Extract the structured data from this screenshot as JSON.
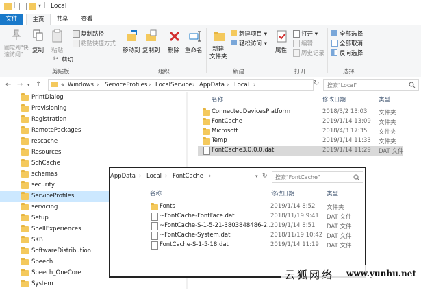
{
  "window": {
    "title": "Local"
  },
  "ribbon_tabs": {
    "file": "文件",
    "home": "主页",
    "share": "共享",
    "view": "查看"
  },
  "ribbon": {
    "pin_quick_access": "固定到\"快\n速访问\"",
    "copy": "复制",
    "paste": "粘贴",
    "copy_path": "复制路径",
    "paste_shortcut": "粘贴快捷方式",
    "cut": "剪切",
    "clipboard_group": "剪贴板",
    "move_to": "移动到",
    "copy_to": "复制到",
    "delete": "删除",
    "rename": "重命名",
    "organize_group": "组织",
    "new_folder": "新建\n文件夹",
    "new_item": "新建项目 ▾",
    "easy_access": "轻松访问 ▾",
    "new_group": "新建",
    "properties": "属性",
    "open": "打开 ▾",
    "edit": "编辑",
    "history": "历史记录",
    "open_group": "打开",
    "select_all": "全部选择",
    "select_none": "全部取消",
    "invert_selection": "反向选择",
    "select_group": "选择"
  },
  "address": {
    "segments": [
      "«",
      "Windows",
      "›",
      "ServiceProfiles",
      "›",
      "LocalService",
      "›",
      "AppData",
      "›",
      "Local",
      "›"
    ],
    "search_placeholder": "搜索\"Local\""
  },
  "sidebar": {
    "items": [
      {
        "label": "PrintDialog"
      },
      {
        "label": "Provisioning"
      },
      {
        "label": "Registration"
      },
      {
        "label": "RemotePackages"
      },
      {
        "label": "rescache"
      },
      {
        "label": "Resources"
      },
      {
        "label": "SchCache"
      },
      {
        "label": "schemas"
      },
      {
        "label": "security"
      },
      {
        "label": "ServiceProfiles"
      },
      {
        "label": "servicing"
      },
      {
        "label": "Setup"
      },
      {
        "label": "ShellExperiences"
      },
      {
        "label": "SKB"
      },
      {
        "label": "SoftwareDistribution"
      },
      {
        "label": "Speech"
      },
      {
        "label": "Speech_OneCore"
      },
      {
        "label": "System"
      }
    ]
  },
  "list": {
    "columns": {
      "name": "名称",
      "date": "修改日期",
      "type": "类型"
    },
    "rows": [
      {
        "name": "ConnectedDevicesPlatform",
        "date": "2018/3/2 13:03",
        "type": "文件夹",
        "kind": "folder"
      },
      {
        "name": "FontCache",
        "date": "2019/1/14 13:09",
        "type": "文件夹",
        "kind": "folder"
      },
      {
        "name": "Microsoft",
        "date": "2018/4/3 17:35",
        "type": "文件夹",
        "kind": "folder"
      },
      {
        "name": "Temp",
        "date": "2019/1/14 11:33",
        "type": "文件夹",
        "kind": "folder"
      },
      {
        "name": "FontCache3.0.0.0.dat",
        "date": "2019/1/14 11:29",
        "type": "DAT 文件",
        "kind": "file"
      }
    ]
  },
  "overlay": {
    "address": [
      "AppData",
      "›",
      "Local",
      "›",
      "FontCache",
      "›"
    ],
    "search_placeholder": "搜索\"FontCache\"",
    "columns": {
      "name": "名称",
      "date": "修改日期",
      "type": "类型"
    },
    "rows": [
      {
        "name": "Fonts",
        "date": "2019/1/14 8:52",
        "type": "文件夹",
        "kind": "folder"
      },
      {
        "name": "~FontCache-FontFace.dat",
        "date": "2018/11/19 9:41",
        "type": "DAT 文件",
        "kind": "file"
      },
      {
        "name": "~FontCache-S-1-5-21-3803848486-2...",
        "date": "2019/1/14 8:51",
        "type": "DAT 文件",
        "kind": "file"
      },
      {
        "name": "~FontCache-System.dat",
        "date": "2018/11/19 10:42",
        "type": "DAT 文件",
        "kind": "file"
      },
      {
        "name": "FontCache-S-1-5-18.dat",
        "date": "2019/1/14 11:19",
        "type": "DAT 文件",
        "kind": "file"
      }
    ]
  },
  "watermark": {
    "cn": "云狐网络",
    "en": "www.yunhu.net"
  },
  "colors": {
    "accent": "#1979ca",
    "selected": "#cce8ff",
    "folder": "#f4c95d"
  }
}
